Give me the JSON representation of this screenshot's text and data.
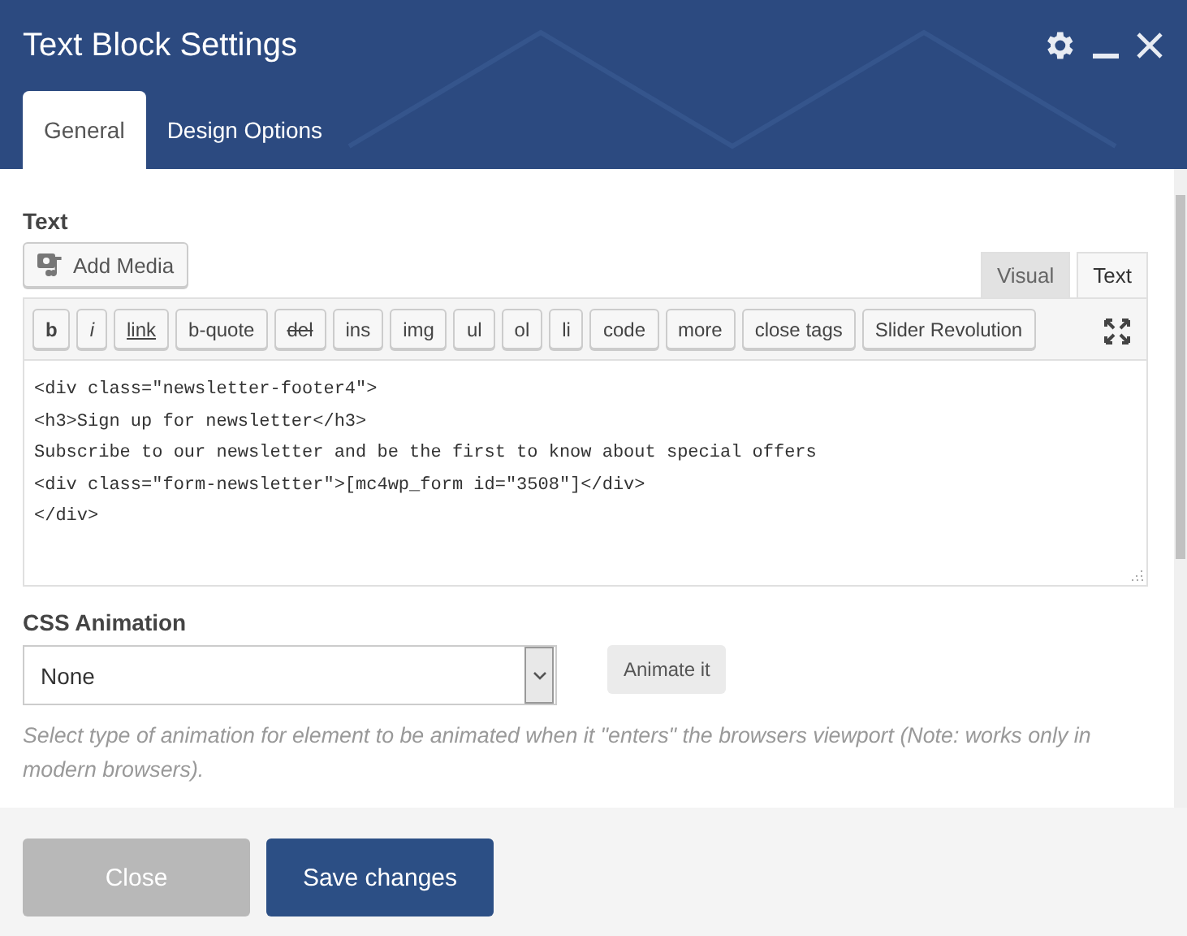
{
  "window": {
    "title": "Text Block Settings"
  },
  "tabs": [
    {
      "label": "General",
      "selected": true
    },
    {
      "label": "Design Options",
      "selected": false
    }
  ],
  "text_field": {
    "label": "Text",
    "add_media": "Add Media",
    "mode_tabs": [
      {
        "label": "Visual",
        "selected": false
      },
      {
        "label": "Text",
        "selected": true
      }
    ],
    "toolbar": [
      {
        "label": "b",
        "kind": "bold"
      },
      {
        "label": "i",
        "kind": "italic"
      },
      {
        "label": "link",
        "kind": "link"
      },
      {
        "label": "b-quote",
        "kind": "plain"
      },
      {
        "label": "del",
        "kind": "del"
      },
      {
        "label": "ins",
        "kind": "plain"
      },
      {
        "label": "img",
        "kind": "plain"
      },
      {
        "label": "ul",
        "kind": "plain"
      },
      {
        "label": "ol",
        "kind": "plain"
      },
      {
        "label": "li",
        "kind": "plain"
      },
      {
        "label": "code",
        "kind": "plain"
      },
      {
        "label": "more",
        "kind": "plain"
      },
      {
        "label": "close tags",
        "kind": "plain"
      },
      {
        "label": "Slider Revolution",
        "kind": "plain"
      }
    ],
    "code_lines": [
      "<div class=\"newsletter-footer4\">",
      "<h3>Sign up for newsletter</h3>",
      "Subscribe to our newsletter and be the first to know about special offers",
      "<div class=\"form-newsletter\">[mc4wp_form id=\"3508\"]</div>",
      "</div>"
    ]
  },
  "css_animation": {
    "label": "CSS Animation",
    "value": "None",
    "button": "Animate it",
    "hint": "Select type of animation for element to be animated when it \"enters\" the browsers viewport (Note: works only in modern browsers)."
  },
  "footer": {
    "buttons": [
      {
        "label": "Close",
        "kind": "secondary"
      },
      {
        "label": "Save changes",
        "kind": "primary"
      }
    ]
  }
}
